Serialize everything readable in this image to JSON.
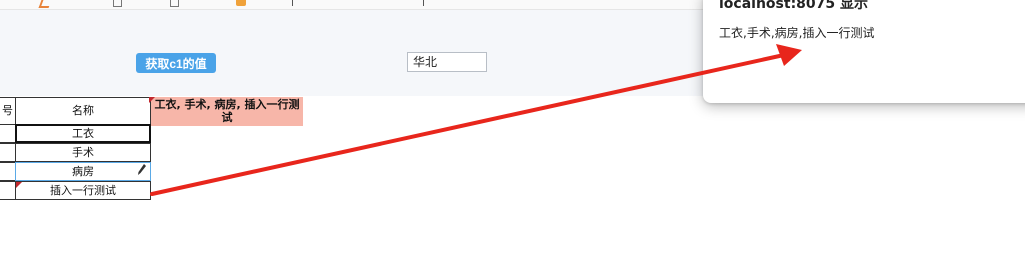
{
  "panel": {
    "button_label": "获取c1的值",
    "input_value": "华北"
  },
  "sheet": {
    "header_seq": "号",
    "header_name": "名称",
    "rows": [
      "工衣",
      "手术",
      "病房",
      "插入一行测试"
    ],
    "result_text": "工衣, 手术, 病房, 插入一行测试"
  },
  "dialog": {
    "title": "localhost:8075 显示",
    "message": "工衣,手术,病房,插入一行测试"
  },
  "colors": {
    "button_blue": "#4aa3e8",
    "result_highlight": "#f7b6a9",
    "arrow_red": "#e8261c",
    "selected_border": "#5aa9e6"
  }
}
